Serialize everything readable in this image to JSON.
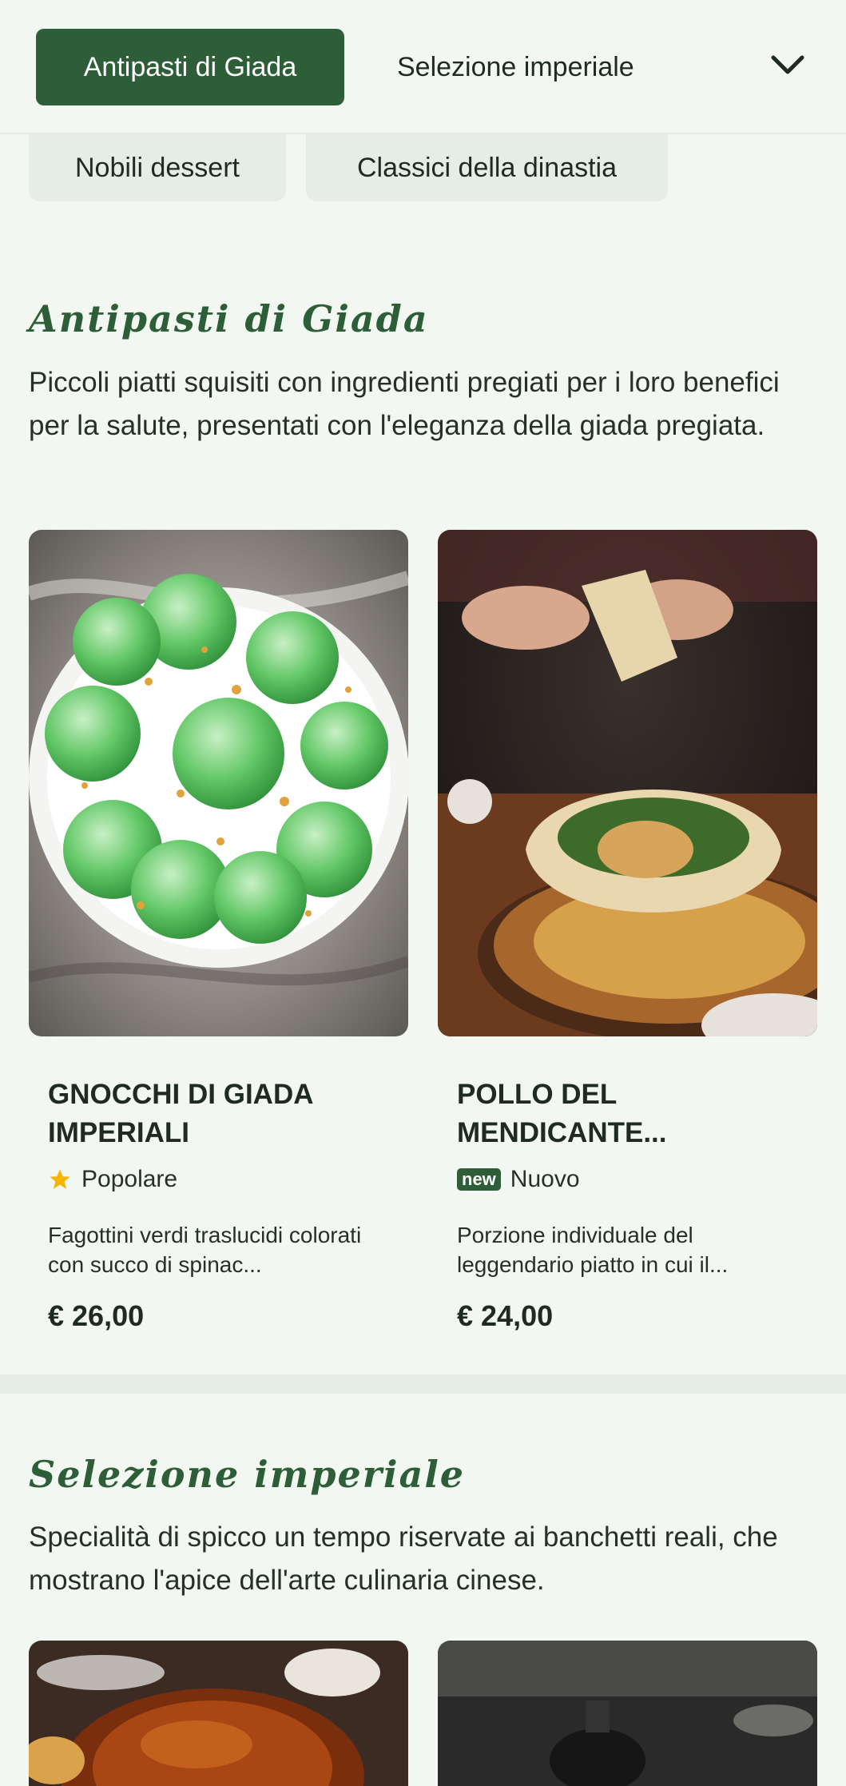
{
  "nav": {
    "tabs": [
      {
        "label": "Antipasti di Giada",
        "active": true
      },
      {
        "label": "Selezione imperiale",
        "active": false
      }
    ],
    "chips": [
      "Nobili dessert",
      "Classici della dinastia"
    ]
  },
  "sections": [
    {
      "title": "Antipasti di Giada",
      "description": "Piccoli piatti squisiti con ingredienti pregiati per i loro benefici per la salute, presentati con l'eleganza della giada pregiata.",
      "items": [
        {
          "name": "GNOCCHI DI GIADA IMPERIALI",
          "badge_icon": "star-icon",
          "badge_label": "Popolare",
          "description": "Fagottini verdi traslucidi colorati con succo di spinac...",
          "price": "€ 26,00"
        },
        {
          "name": "POLLO DEL MENDICANTE...",
          "badge_tag": "new",
          "badge_label": "Nuovo",
          "description": "Porzione individuale del leggendario piatto in cui il...",
          "price": "€ 24,00"
        }
      ]
    },
    {
      "title": "Selezione imperiale",
      "description": "Specialità di spicco un tempo riservate ai banchetti reali, che mostrano l'apice dell'arte culinaria cinese."
    }
  ],
  "colors": {
    "accent": "#2e5e38",
    "background": "#f2f7f2",
    "star": "#f4b400"
  }
}
